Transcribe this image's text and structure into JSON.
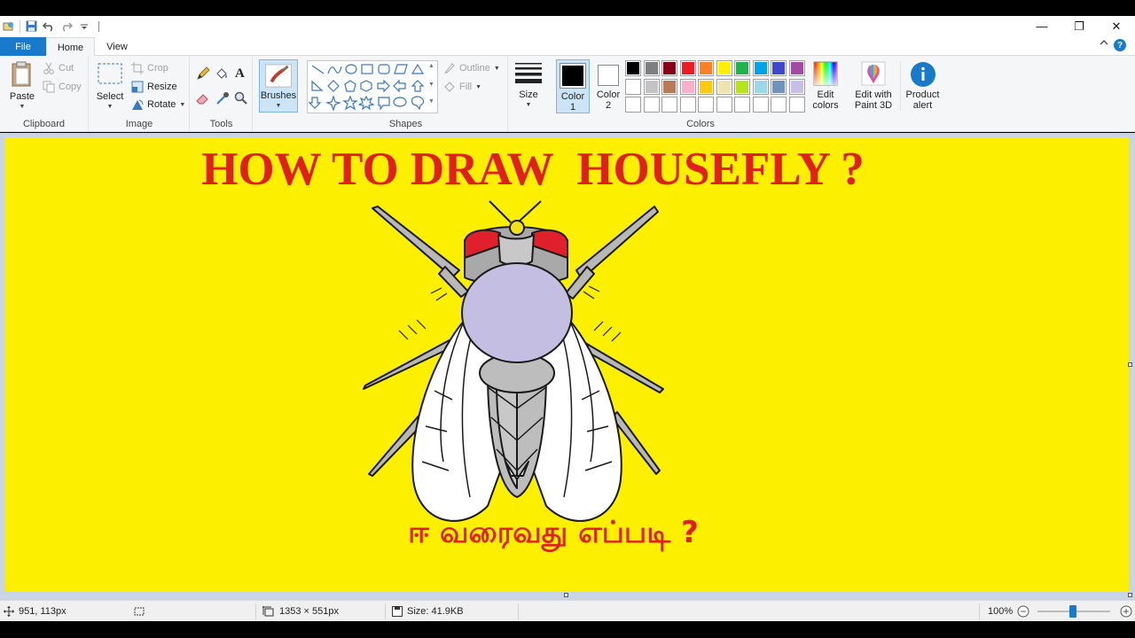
{
  "window": {
    "minimize_glyph": "—",
    "restore_glyph": "❐",
    "close_glyph": "✕"
  },
  "tabs": {
    "file": "File",
    "home": "Home",
    "view": "View"
  },
  "ribbon": {
    "clipboard": {
      "label": "Clipboard",
      "paste": "Paste",
      "cut": "Cut",
      "copy": "Copy"
    },
    "image": {
      "label": "Image",
      "select": "Select",
      "crop": "Crop",
      "resize": "Resize",
      "rotate": "Rotate"
    },
    "tools": {
      "label": "Tools",
      "text_glyph": "A"
    },
    "brushes": {
      "label": "Brushes"
    },
    "shapes": {
      "label": "Shapes",
      "outline": "Outline",
      "fill": "Fill"
    },
    "size": {
      "label": "Size"
    },
    "color1": {
      "label": "Color",
      "num": "1",
      "value": "#000000"
    },
    "color2": {
      "label": "Color",
      "num": "2",
      "value": "#ffffff"
    },
    "colors": {
      "label": "Colors"
    },
    "edit_colors": {
      "line1": "Edit",
      "line2": "colors"
    },
    "paint3d": {
      "line1": "Edit with",
      "line2": "Paint 3D"
    },
    "product_alert": {
      "line1": "Product",
      "line2": "alert"
    },
    "palette": [
      "#000000",
      "#7f7f7f",
      "#880015",
      "#ed1c24",
      "#ff7f27",
      "#fff200",
      "#22b14c",
      "#00a2e8",
      "#3f48cc",
      "#a349a4",
      "#ffffff",
      "#c3c3c3",
      "#b97a57",
      "#ffaec9",
      "#ffc90e",
      "#efe4b0",
      "#b5e61d",
      "#99d9ea",
      "#7092be",
      "#c8bfe7",
      "#ffffff",
      "#ffffff",
      "#ffffff",
      "#ffffff",
      "#ffffff",
      "#ffffff",
      "#ffffff",
      "#ffffff",
      "#ffffff",
      "#ffffff"
    ]
  },
  "canvas": {
    "background": "#fcef00",
    "title": "HOW TO DRAW  HOUSEFLY ?",
    "subtitle": "ஈ வரைவது எப்படி ?",
    "text_color": "#e0201c"
  },
  "status": {
    "cursor": "951, 113px",
    "canvas_size": "1353 × 551px",
    "file_size": "Size: 41.9KB",
    "zoom": "100%"
  }
}
